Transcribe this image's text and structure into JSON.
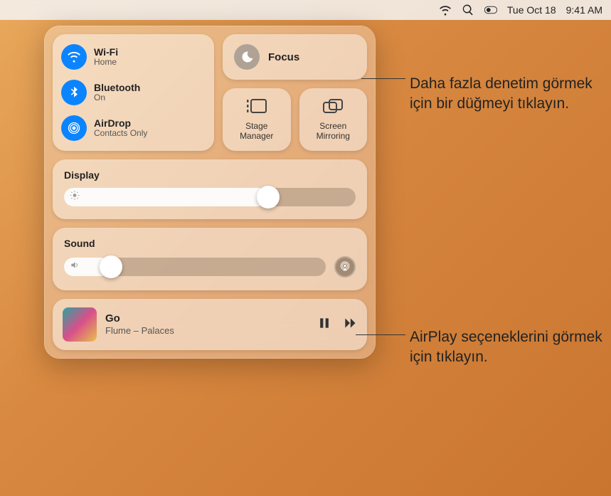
{
  "menubar": {
    "date": "Tue Oct 18",
    "time": "9:41 AM"
  },
  "connectivity": {
    "wifi": {
      "title": "Wi-Fi",
      "subtitle": "Home"
    },
    "bluetooth": {
      "title": "Bluetooth",
      "subtitle": "On"
    },
    "airdrop": {
      "title": "AirDrop",
      "subtitle": "Contacts Only"
    }
  },
  "focus": {
    "title": "Focus"
  },
  "stage_manager": {
    "label": "Stage\nManager"
  },
  "screen_mirroring": {
    "label": "Screen\nMirroring"
  },
  "display": {
    "title": "Display",
    "value_pct": 70
  },
  "sound": {
    "title": "Sound",
    "value_pct": 18
  },
  "now_playing": {
    "track": "Go",
    "artist_album": "Flume – Palaces"
  },
  "callouts": {
    "c1": "Daha fazla denetim görmek için bir düğmeyi tıklayın.",
    "c2": "AirPlay seçeneklerini görmek için tıklayın."
  },
  "chart_data": null
}
